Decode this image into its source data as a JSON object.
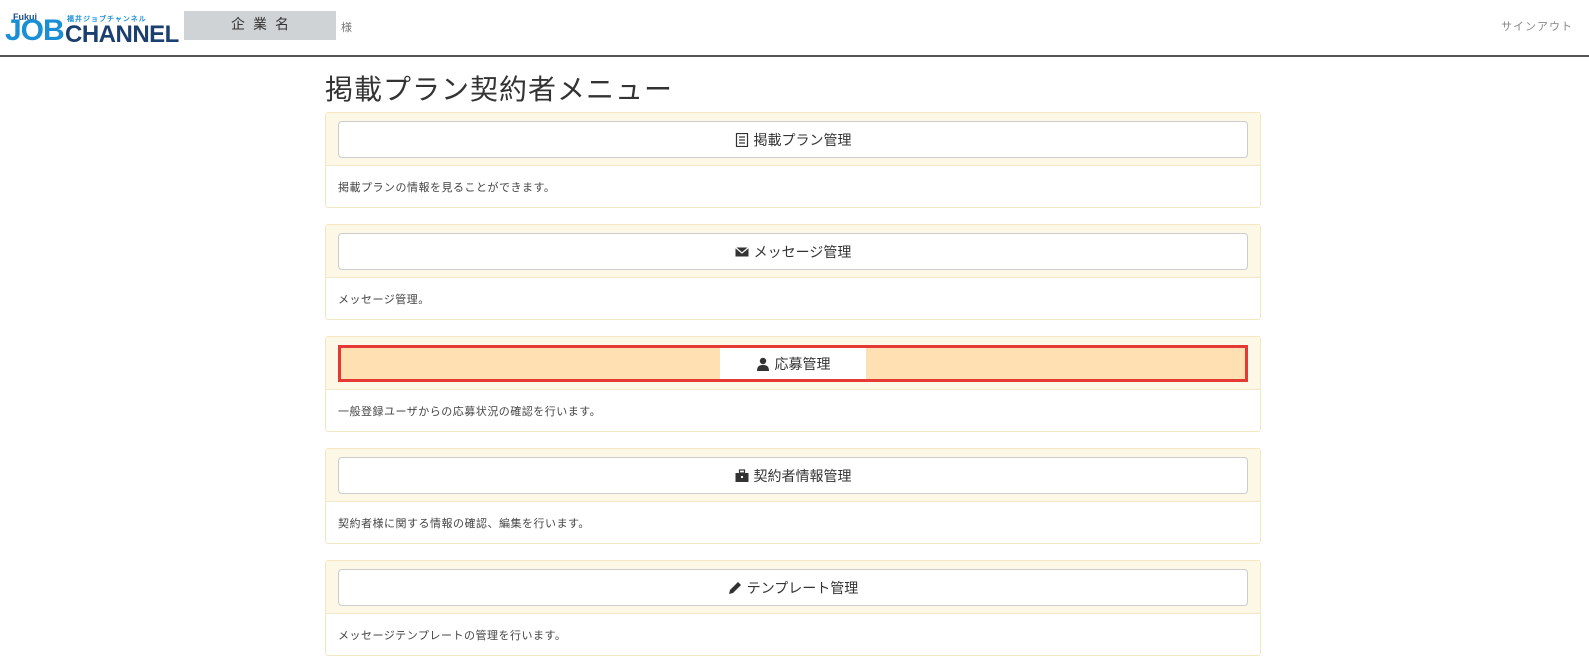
{
  "header": {
    "logo_fukui": "Fukui",
    "logo_job": "JOB",
    "logo_channel": "CHANNEL",
    "logo_jp": "福井ジョブチャンネル",
    "company_name": "企業名",
    "honorific": "様",
    "signout_label": "サインアウト"
  },
  "page": {
    "title": "掲載プラン契約者メニュー"
  },
  "panels": [
    {
      "button_label": "掲載プラン管理",
      "description": "掲載プランの情報を見ることができます。",
      "icon": "list-icon"
    },
    {
      "button_label": "メッセージ管理",
      "description": "メッセージ管理。",
      "icon": "envelope-icon"
    },
    {
      "button_label": "応募管理",
      "description": "一般登録ユーザからの応募状況の確認を行います。",
      "icon": "user-icon"
    },
    {
      "button_label": "契約者情報管理",
      "description": "契約者様に関する情報の確認、編集を行います。",
      "icon": "briefcase-icon"
    },
    {
      "button_label": "テンプレート管理",
      "description": "メッセージテンプレートの管理を行います。",
      "icon": "pencil-icon"
    }
  ],
  "colors": {
    "panel_header_bg": "#fcf8e5",
    "highlight_border": "#e53935",
    "highlight_bg": "#ffe0b2",
    "logo_blue": "#1a8fd6",
    "logo_navy": "#1b3f6e"
  }
}
